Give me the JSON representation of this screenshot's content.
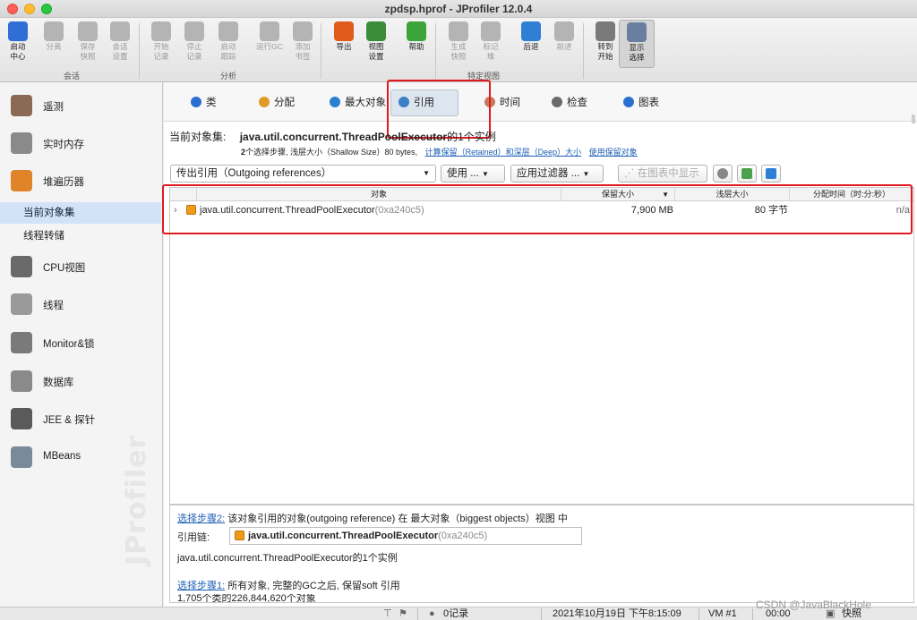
{
  "window": {
    "title": "zpdsp.hprof - JProfiler 12.0.4"
  },
  "toolbar": {
    "buttons": [
      {
        "name": "start-center",
        "label1": "启动",
        "label2": "中心",
        "color": "#2f6ed4",
        "enabled": true
      },
      {
        "name": "detach",
        "label1": "分离",
        "label2": "",
        "color": "#8a8a8a",
        "enabled": false
      },
      {
        "name": "save-snapshot",
        "label1": "保存",
        "label2": "快照",
        "color": "#8a8a8a",
        "enabled": false
      },
      {
        "name": "session-settings",
        "label1": "会话",
        "label2": "设置",
        "color": "#8a8a8a",
        "enabled": false
      },
      {
        "name": "start-recording",
        "label1": "开始",
        "label2": "记录",
        "color": "#8a8a8a",
        "enabled": false
      },
      {
        "name": "stop-recording",
        "label1": "停止",
        "label2": "记录",
        "color": "#8a8a8a",
        "enabled": false
      },
      {
        "name": "start-tracking",
        "label1": "启动",
        "label2": "跟踪",
        "color": "#8a8a8a",
        "enabled": false
      },
      {
        "name": "run-gc",
        "label1": "运行GC",
        "label2": "",
        "color": "#8a8a8a",
        "enabled": false
      },
      {
        "name": "add-bookmark",
        "label1": "添加",
        "label2": "书签",
        "color": "#8a8a8a",
        "enabled": false
      },
      {
        "name": "export",
        "label1": "导出",
        "label2": "",
        "color": "#e05a1c",
        "enabled": true
      },
      {
        "name": "view-settings",
        "label1": "视图",
        "label2": "设置",
        "color": "#3b8c3b",
        "enabled": true
      },
      {
        "name": "help",
        "label1": "帮助",
        "label2": "",
        "color": "#3aa43a",
        "enabled": true
      },
      {
        "name": "take-snapshot",
        "label1": "生成",
        "label2": "快照",
        "color": "#8a8a8a",
        "enabled": false
      },
      {
        "name": "mark-heap",
        "label1": "标记",
        "label2": "堆",
        "color": "#8a8a8a",
        "enabled": false
      },
      {
        "name": "back",
        "label1": "后退",
        "label2": "",
        "color": "#2f7fd4",
        "enabled": true
      },
      {
        "name": "forward",
        "label1": "前进",
        "label2": "",
        "color": "#8a8a8a",
        "enabled": false
      },
      {
        "name": "go-to-start",
        "label1": "转到",
        "label2": "开始",
        "color": "#7a7a7a",
        "enabled": true
      },
      {
        "name": "show-selection",
        "label1": "显示",
        "label2": "选择",
        "color": "#6a7fa0",
        "enabled": true
      }
    ],
    "groups": {
      "session": "会话",
      "profiling": "分析",
      "view_specific": "特定视图"
    }
  },
  "sidebar": {
    "items": [
      {
        "key": "telemetry",
        "label": "遥测",
        "color": "#8a6a52"
      },
      {
        "key": "live-memory",
        "label": "实时内存",
        "color": "#8a8a8a"
      },
      {
        "key": "heap-walker",
        "label": "堆遍历器",
        "color": "#e0842a"
      },
      {
        "key": "cpu-views",
        "label": "CPU视图",
        "color": "#6a6a6a"
      },
      {
        "key": "threads",
        "label": "线程",
        "color": "#9a9a9a"
      },
      {
        "key": "monitors-locks",
        "label": "Monitor&锁",
        "color": "#7a7a7a"
      },
      {
        "key": "databases",
        "label": "数据库",
        "color": "#8a8a8a"
      },
      {
        "key": "jee-probes",
        "label": "JEE & 探针",
        "color": "#5a5a5a"
      },
      {
        "key": "mbeans",
        "label": "MBeans",
        "color": "#7a8a9a"
      }
    ],
    "subitems": {
      "current_object_set": "当前对象集",
      "thread_dump": "线程转储"
    },
    "watermark": "JProfiler"
  },
  "tabs": [
    {
      "key": "classes",
      "label": "类",
      "color": "#2a6fd0"
    },
    {
      "key": "allocations",
      "label": "分配",
      "color": "#e09a2a"
    },
    {
      "key": "biggest-objects",
      "label": "最大对象",
      "color": "#2a7fd0"
    },
    {
      "key": "references",
      "label": "引用",
      "color": "#3b7fc4"
    },
    {
      "key": "time",
      "label": "时间",
      "color": "#c77a5a"
    },
    {
      "key": "inspections",
      "label": "检查",
      "color": "#6a6a6a"
    },
    {
      "key": "graph",
      "label": "图表",
      "color": "#2a6fd0"
    }
  ],
  "current_set": {
    "label": "当前对象集:",
    "value": "java.util.concurrent.ThreadPoolExecutor",
    "suffix": "的1个实例",
    "steps": "2",
    "detail": "个选择步骤, 浅层大小（Shallow Size）80 bytes,",
    "link_retained": "计算保留（Retained）和深层（Deep）大小",
    "link_use_retained": "使用保留对象"
  },
  "controls": {
    "outgoing": "传出引用（Outgoing references）",
    "use": "使用 ...",
    "apply_filter": "应用过滤器 ...",
    "show_in_graph": "在图表中显示"
  },
  "table": {
    "columns": {
      "object": "对象",
      "retained": "保留大小",
      "shallow": "浅层大小",
      "alloc_time": "分配时间（时:分:秒）"
    },
    "rows": [
      {
        "name": "java.util.concurrent.ThreadPoolExecutor",
        "id": "(0xa240c5)",
        "retained": "7,900 MB",
        "shallow": "80 字节",
        "alloc_time": "n/a"
      }
    ]
  },
  "bottom": {
    "step2_link": "选择步骤2:",
    "step2_text": " 该对象引用的对象(outgoing reference) 在 最大对象（biggest objects）视图 中",
    "chain_label": "引用链:",
    "chain_value": "java.util.concurrent.ThreadPoolExecutor",
    "chain_id": "(0xa240c5)",
    "instances": "java.util.concurrent.ThreadPoolExecutor的1个实例",
    "step1_link": "选择步骤1:",
    "step1_text": " 所有对象, 完整的GC之后, 保留soft 引用",
    "cut_line": "1,705个类的226,844,620个对象"
  },
  "status": {
    "records": "0记录",
    "datetime": "2021年10月19日 下午8:15:09",
    "vm": "VM #1",
    "elapsed": "00:00",
    "snapshot": "快照",
    "credit": "CSDN @JavaBlackHole"
  }
}
